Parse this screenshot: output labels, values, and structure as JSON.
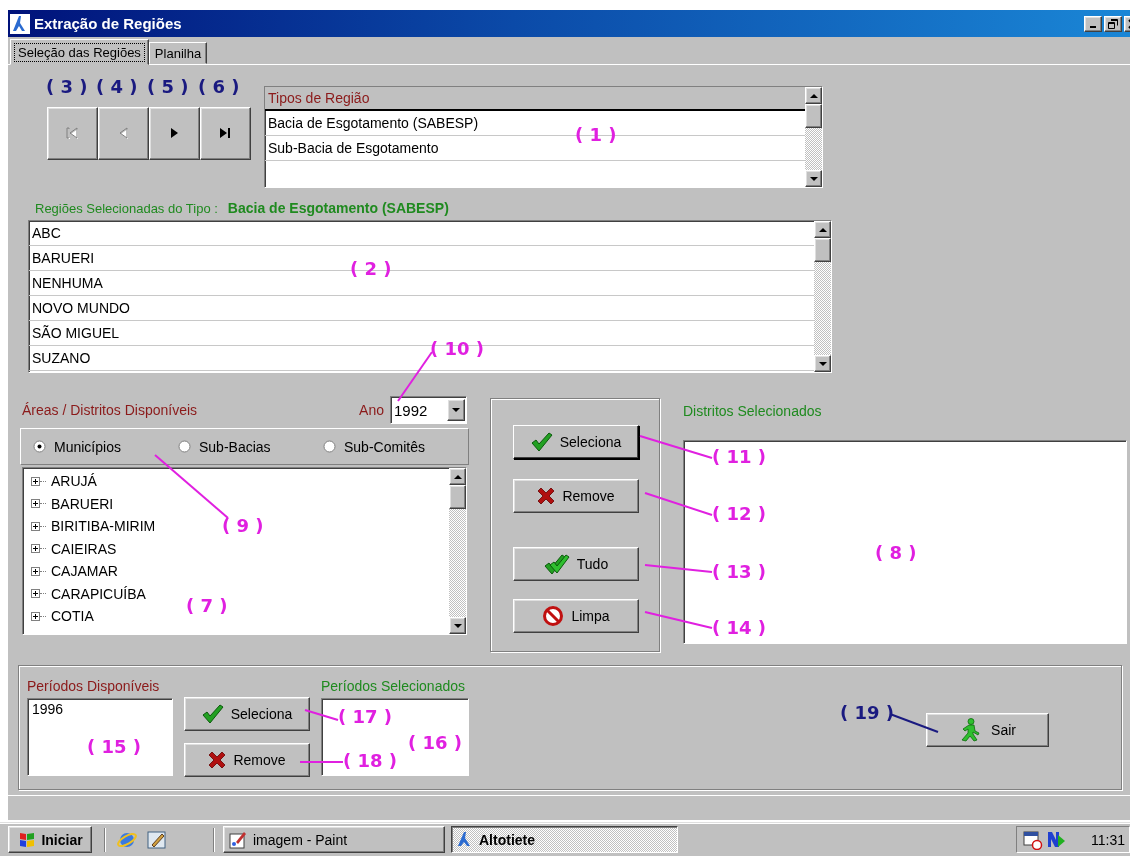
{
  "window": {
    "title": "Extração de Regiões"
  },
  "tabs": [
    {
      "label": "Seleção das Regiões",
      "selected": true
    },
    {
      "label": "Planilha",
      "selected": false
    }
  ],
  "nav_buttons": [
    {
      "kind": "first",
      "disabled": true
    },
    {
      "kind": "prev",
      "disabled": true
    },
    {
      "kind": "next",
      "disabled": false
    },
    {
      "kind": "last",
      "disabled": false
    }
  ],
  "region_types": {
    "header": "Tipos de Região",
    "rows": [
      "Bacia de Esgotamento (SABESP)",
      "Sub-Bacia de Esgotamento"
    ]
  },
  "selected_regions": {
    "label": "Regiões Selecionadas do Tipo :",
    "type": "Bacia de Esgotamento (SABESP)",
    "rows": [
      "ABC",
      "BARUERI",
      "NENHUMA",
      "NOVO MUNDO",
      "SÃO MIGUEL",
      "SUZANO"
    ]
  },
  "available_areas": {
    "label": "Áreas / Distritos Disponíveis",
    "year_label": "Ano",
    "year": "1992",
    "options": [
      {
        "label": "Municípios",
        "selected": true
      },
      {
        "label": "Sub-Bacias",
        "selected": false
      },
      {
        "label": "Sub-Comitês",
        "selected": false
      }
    ],
    "tree": [
      "ARUJÁ",
      "BARUERI",
      "BIRITIBA-MIRIM",
      "CAIEIRAS",
      "CAJAMAR",
      "CARAPICUÍBA",
      "COTIA"
    ]
  },
  "actions": [
    {
      "kind": "check",
      "label": "Seleciona"
    },
    {
      "kind": "cross",
      "label": "Remove"
    },
    {
      "kind": "double-check",
      "label": "Tudo"
    },
    {
      "kind": "no",
      "label": "Limpa"
    }
  ],
  "selected_districts": {
    "label": "Distritos Selecionados"
  },
  "periods": {
    "available_label": "Períodos Disponíveis",
    "available": [
      "1996"
    ],
    "selected_label": "Períodos Selecionados",
    "actions": [
      {
        "kind": "check",
        "label": "Seleciona"
      },
      {
        "kind": "cross",
        "label": "Remove"
      }
    ]
  },
  "exit_button": {
    "label": "Sair"
  },
  "annotations": [
    {
      "label": "( 3 )",
      "color": "#1a1a80"
    },
    {
      "label": "( 4 )",
      "color": "#1a1a80"
    },
    {
      "label": "( 5 )",
      "color": "#1a1a80"
    },
    {
      "label": "( 6 )",
      "color": "#1a1a80"
    },
    {
      "label": "( 1 )",
      "color": "#e020e0"
    },
    {
      "label": "( 2 )",
      "color": "#e020e0"
    },
    {
      "label": "( 10 )",
      "color": "#e020e0"
    },
    {
      "label": "( 9 )",
      "color": "#e020e0"
    },
    {
      "label": "( 11 )",
      "color": "#e020e0"
    },
    {
      "label": "( 12 )",
      "color": "#e020e0"
    },
    {
      "label": "( 13 )",
      "color": "#e020e0"
    },
    {
      "label": "( 14 )",
      "color": "#e020e0"
    },
    {
      "label": "( 8 )",
      "color": "#e020e0"
    },
    {
      "label": "( 7 )",
      "color": "#e020e0"
    },
    {
      "label": "( 15 )",
      "color": "#e020e0"
    },
    {
      "label": "( 17 )",
      "color": "#e020e0"
    },
    {
      "label": "( 18 )",
      "color": "#e020e0"
    },
    {
      "label": "( 16 )",
      "color": "#e020e0"
    },
    {
      "label": "( 19 )",
      "color": "#1a1a80"
    }
  ],
  "taskbar": {
    "start": "Iniciar",
    "tasks": [
      {
        "label": "imagem - Paint",
        "selected": false
      },
      {
        "label": "Altotiete",
        "selected": true
      }
    ],
    "clock": "11:31"
  }
}
